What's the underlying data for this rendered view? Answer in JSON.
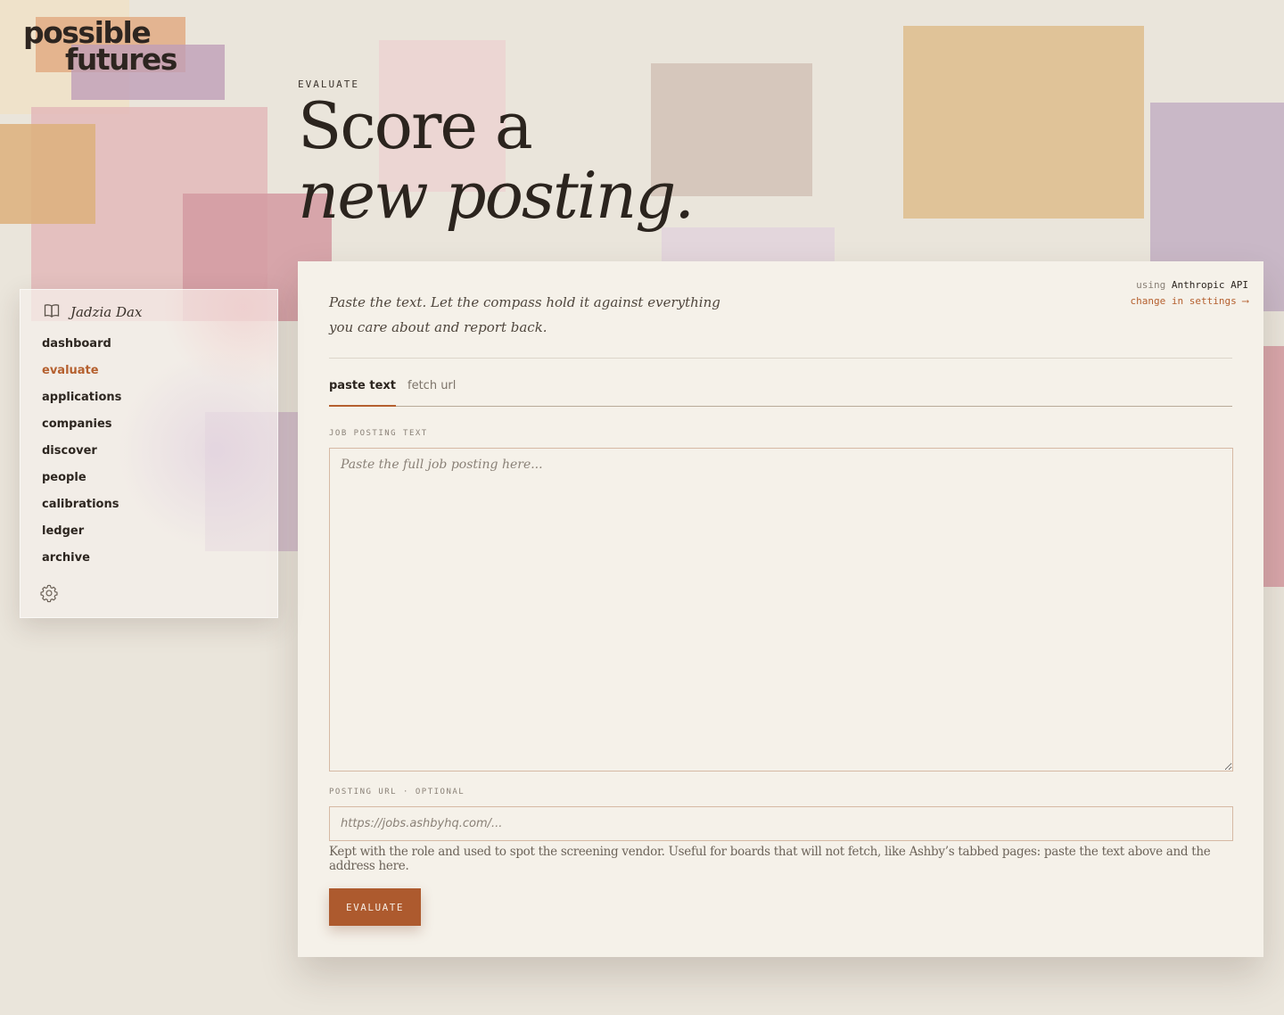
{
  "brand": {
    "line1": "possible",
    "line2": "futures"
  },
  "user": {
    "name": "Jadzia Dax",
    "icon": "book-icon"
  },
  "nav": [
    {
      "label": "dashboard",
      "active": false
    },
    {
      "label": "evaluate",
      "active": true
    },
    {
      "label": "applications",
      "active": false
    },
    {
      "label": "companies",
      "active": false
    },
    {
      "label": "discover",
      "active": false
    },
    {
      "label": "people",
      "active": false
    },
    {
      "label": "calibrations",
      "active": false
    },
    {
      "label": "ledger",
      "active": false
    },
    {
      "label": "archive",
      "active": false
    }
  ],
  "settings_icon": "gear-icon",
  "page": {
    "eyebrow": "EVALUATE",
    "headline_line1": "Score a",
    "headline_line2": "new posting."
  },
  "api": {
    "using": "using",
    "provider": "Anthropic API",
    "change_link": "change in settings ⟶"
  },
  "intro": "Paste the text. Let the compass hold it against everything you care about and report back.",
  "tabs": [
    {
      "label": "paste text",
      "active": true
    },
    {
      "label": "fetch url",
      "active": false
    }
  ],
  "form": {
    "posting_label": "JOB POSTING TEXT",
    "posting_placeholder": "Paste the full job posting here...",
    "url_label": "POSTING URL · OPTIONAL",
    "url_placeholder": "https://jobs.ashbyhq.com/...",
    "url_help": "Kept with the role and used to spot the screening vendor. Useful for boards that will not fetch, like Ashby’s tabbed pages: paste the text above and the address here.",
    "submit_label": "EVALUATE"
  },
  "colors": {
    "accent": "#b5602f",
    "button": "#ad5a2e",
    "background": "#eae5db",
    "card": "#f5f1e9"
  }
}
